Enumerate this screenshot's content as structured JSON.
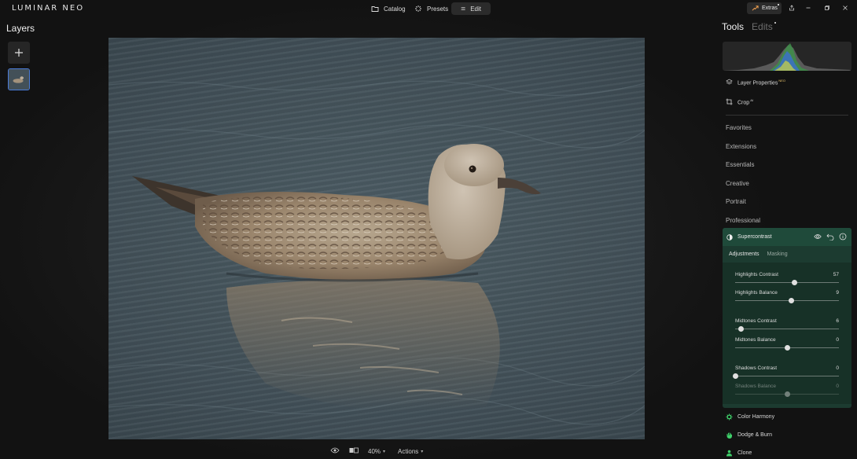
{
  "app": {
    "brand": "LUMINAR NEO"
  },
  "nav": {
    "catalog": "Catalog",
    "presets": "Presets",
    "edit": "Edit",
    "extras": "Extras"
  },
  "layers": {
    "title": "Layers"
  },
  "bottom": {
    "zoom": "40%",
    "actions": "Actions"
  },
  "tools": {
    "tab_tools": "Tools",
    "tab_edits": "Edits",
    "layer_properties": "Layer Properties",
    "layer_properties_badge": "NEO",
    "crop": "Crop",
    "crop_badge": "AI",
    "categories": [
      "Favorites",
      "Extensions",
      "Essentials",
      "Creative",
      "Portrait",
      "Professional"
    ]
  },
  "supercontrast": {
    "title": "Supercontrast",
    "tab_adjustments": "Adjustments",
    "tab_masking": "Masking",
    "sliders": [
      {
        "label": "Highlights Contrast",
        "value": "57",
        "fraction": 0.57
      },
      {
        "label": "Highlights Balance",
        "value": "9",
        "fraction": 0.545
      },
      {
        "label": "Midtones Contrast",
        "value": "6",
        "fraction": 0.06
      },
      {
        "label": "Midtones Balance",
        "value": "0",
        "fraction": 0.5
      },
      {
        "label": "Shadows Contrast",
        "value": "0",
        "fraction": 0.0
      },
      {
        "label": "Shadows Balance",
        "value": "0",
        "fraction": 0.5
      }
    ]
  },
  "more_tools": {
    "color_harmony": "Color Harmony",
    "dodge_burn": "Dodge & Burn",
    "clone": "Clone"
  },
  "colors": {
    "accent_blue": "#4a7bd8",
    "panel_green": "#1c3b30",
    "neo_gold": "#e6c26a",
    "tool_green": "#3fd06a"
  }
}
